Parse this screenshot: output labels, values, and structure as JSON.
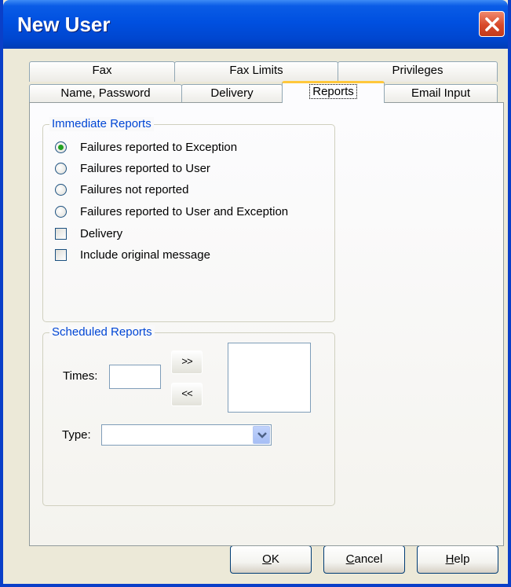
{
  "window": {
    "title": "New User"
  },
  "tabs_row_back": [
    {
      "label": "Fax"
    },
    {
      "label": "Fax Limits"
    },
    {
      "label": "Privileges"
    }
  ],
  "tabs_row_front": [
    {
      "label": "Name, Password"
    },
    {
      "label": "Delivery"
    },
    {
      "label": "Reports"
    },
    {
      "label": "Email Input"
    }
  ],
  "immediate_reports": {
    "title": "Immediate Reports",
    "radio_options": [
      {
        "label": "Failures reported to Exception",
        "selected": true
      },
      {
        "label": "Failures reported to User",
        "selected": false
      },
      {
        "label": "Failures not reported",
        "selected": false
      },
      {
        "label": "Failures reported to User and Exception",
        "selected": false
      }
    ],
    "checkboxes": [
      {
        "label": "Delivery",
        "checked": false
      },
      {
        "label": "Include original message",
        "checked": false
      }
    ]
  },
  "scheduled_reports": {
    "title": "Scheduled Reports",
    "times_label": "Times:",
    "times_value": "",
    "add_label": ">>",
    "remove_label": "<<",
    "type_label": "Type:",
    "type_value": ""
  },
  "buttons": {
    "ok": {
      "mnemonic": "O",
      "rest": "K"
    },
    "cancel": {
      "mnemonic": "C",
      "rest": "ancel"
    },
    "help": {
      "mnemonic": "H",
      "rest": "elp"
    }
  },
  "colors": {
    "title_bar": "#0050E0",
    "window_face": "#ECE9D8",
    "group_title": "#0046D5",
    "selected_radio": "#21A121",
    "active_tab_highlight": "#FFC83C"
  }
}
